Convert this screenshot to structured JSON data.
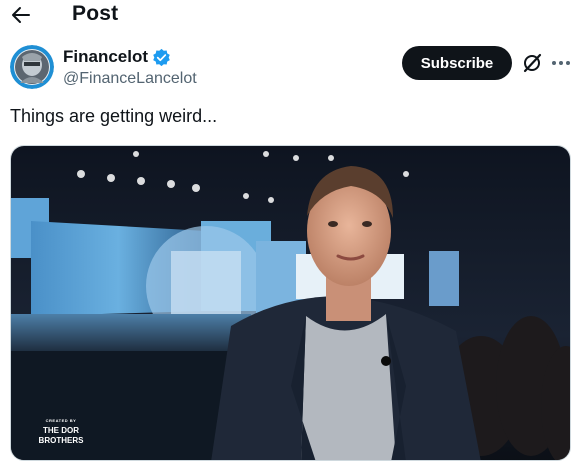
{
  "header": {
    "title": "Post"
  },
  "author": {
    "display_name": "Financelot",
    "handle": "@FinanceLancelot",
    "verified": true,
    "subscribe_label": "Subscribe"
  },
  "post": {
    "text": "Things are getting weird..."
  },
  "media": {
    "watermark_small": "CREATED BY",
    "watermark_line1": "THE DOR",
    "watermark_line2": "BROTHERS"
  },
  "colors": {
    "accent": "#1d9bf0",
    "text": "#0f1419",
    "secondary": "#536471",
    "button": "#0f1419"
  },
  "icons": [
    "back-arrow-icon",
    "verified-badge-icon",
    "grok-icon",
    "more-icon"
  ]
}
